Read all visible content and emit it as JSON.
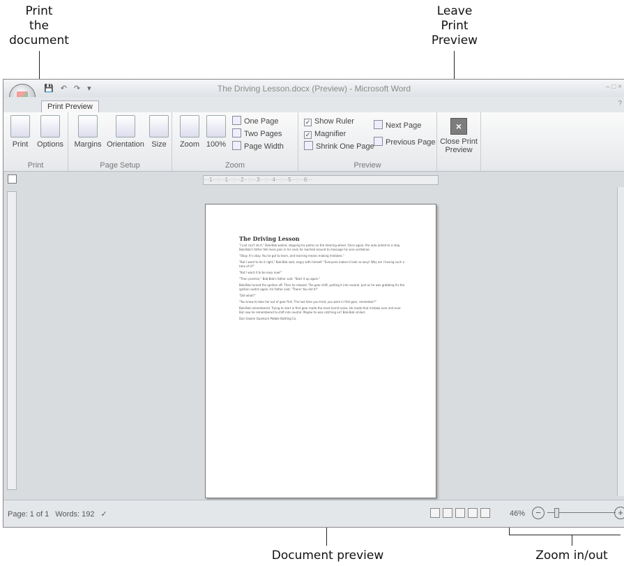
{
  "callouts": {
    "print": [
      "Print",
      "the",
      "document"
    ],
    "leave": [
      "Leave",
      "Print",
      "Preview"
    ],
    "document_preview": "Document preview",
    "zoom": "Zoom in/out"
  },
  "window": {
    "title": "The Driving Lesson.docx (Preview) - Microsoft Word",
    "tab": "Print Preview"
  },
  "ribbon": {
    "groups": {
      "print": "Print",
      "page_setup": "Page Setup",
      "zoom": "Zoom",
      "preview": "Preview"
    },
    "print_label": "Print",
    "options_label": "Options",
    "margins_label": "Margins",
    "orientation_label": "Orientation",
    "size_label": "Size",
    "zoom_label": "Zoom",
    "hundred_label": "100%",
    "one_page": "One Page",
    "two_pages": "Two Pages",
    "page_width": "Page Width",
    "show_ruler": "Show Ruler",
    "magnifier": "Magnifier",
    "shrink_one_page": "Shrink One Page",
    "next_page": "Next Page",
    "previous_page": "Previous Page",
    "close_print": "Close Print",
    "close_preview": "Preview"
  },
  "document": {
    "heading": "The Driving Lesson",
    "paragraphs": [
      "\"I just can't do it,\" Bob-Bob wailed, slapping his palms on the steering wheel. Once again, the auto jerked to a stop. Bob-Bob's father felt more pain in his neck he reached around to massage his sore vertebrae.",
      "\"Okay. It's okay. You've got to learn, and learning means making mistakes.\"",
      "\"But I want to do it right,\" Bob-Bob said, angry with himself. \"Everyone makes it look so easy! Why am I having such a time of it?\"",
      "\"But I want it to be easy now!\"",
      "\"Then practice,\" Bob-Bob's father said. \"Start it up again.\"",
      "Bob-Bob turned the ignition off. Then he relaxed. The gear shift, putting it into neutral. Just as he was grabbing for the ignition switch again, his father said, \"There! You did it!\"",
      "\"Did what?\"",
      "\"You knew to take her out of gear first. The last time you tried, you were in first gear, remember?\"",
      "Bob-Bob remembered. Trying to start in first gear made the most horrid noise. He made that mistake over and over. But now he remembered to shift into neutral. Maybe he was catching on? Bob-Bob smiled.",
      "Dan Gookin Quantum Pebble Bottling Co."
    ]
  },
  "status": {
    "page": "Page: 1 of 1",
    "words": "Words: 192",
    "zoom_level": "46%"
  }
}
